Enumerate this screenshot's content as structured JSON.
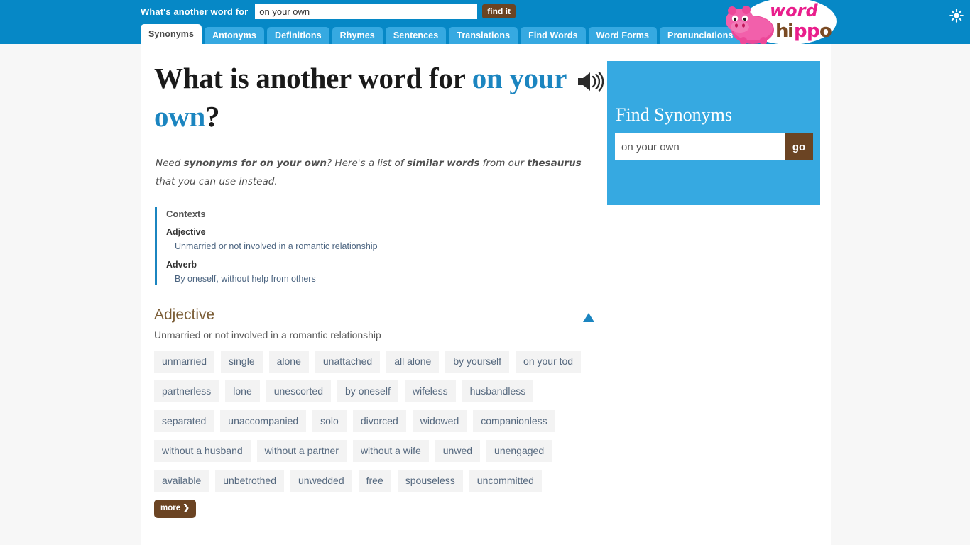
{
  "header": {
    "search_label": "What's another word for",
    "search_value": "on your own",
    "search_placeholder": "",
    "find_button": "find it",
    "logo_word": "word",
    "logo_hippo": "hippo",
    "accent_blue": "#0688c6",
    "tab_blue": "#36a9e1",
    "brown": "#6b4423"
  },
  "tabs": [
    {
      "label": "Synonyms",
      "active": true
    },
    {
      "label": "Antonyms",
      "active": false
    },
    {
      "label": "Definitions",
      "active": false
    },
    {
      "label": "Rhymes",
      "active": false
    },
    {
      "label": "Sentences",
      "active": false
    },
    {
      "label": "Translations",
      "active": false
    },
    {
      "label": "Find Words",
      "active": false
    },
    {
      "label": "Word Forms",
      "active": false
    },
    {
      "label": "Pronunciations",
      "active": false
    }
  ],
  "main": {
    "title_prefix": "What is another word for ",
    "title_term": "on your own",
    "title_suffix": "?",
    "lede_parts": [
      {
        "text": "Need ",
        "bold": false
      },
      {
        "text": "synonyms for on your own",
        "bold": true
      },
      {
        "text": "? Here's a list of ",
        "bold": false
      },
      {
        "text": "similar words",
        "bold": true
      },
      {
        "text": " from our ",
        "bold": false
      },
      {
        "text": "thesaurus",
        "bold": true
      },
      {
        "text": " that you can use instead.",
        "bold": false
      }
    ],
    "speaker_icon": "speaker-icon"
  },
  "contexts": {
    "heading": "Contexts",
    "groups": [
      {
        "pos": "Adjective",
        "definition": "Unmarried or not involved in a romantic relationship"
      },
      {
        "pos": "Adverb",
        "definition": "By oneself, without help from others"
      }
    ]
  },
  "section": {
    "heading": "Adjective",
    "subheading": "Unmarried or not involved in a romantic relationship",
    "collapse_icon": "triangle-up-icon",
    "words": [
      "unmarried",
      "single",
      "alone",
      "unattached",
      "all alone",
      "by yourself",
      "on your tod",
      "partnerless",
      "lone",
      "unescorted",
      "by oneself",
      "wifeless",
      "husbandless",
      "separated",
      "unaccompanied",
      "solo",
      "divorced",
      "widowed",
      "companionless",
      "without a husband",
      "without a partner",
      "without a wife",
      "unwed",
      "unengaged",
      "available",
      "unbetrothed",
      "unwedded",
      "free",
      "spouseless",
      "uncommitted"
    ],
    "more_label": "more ❯"
  },
  "sidebar": {
    "title": "Find Synonyms",
    "input_value": "on your own",
    "input_placeholder": "",
    "go_label": "go",
    "panel_color": "#36a9e1"
  },
  "misc": {
    "star_icon": "sun-star-icon"
  }
}
